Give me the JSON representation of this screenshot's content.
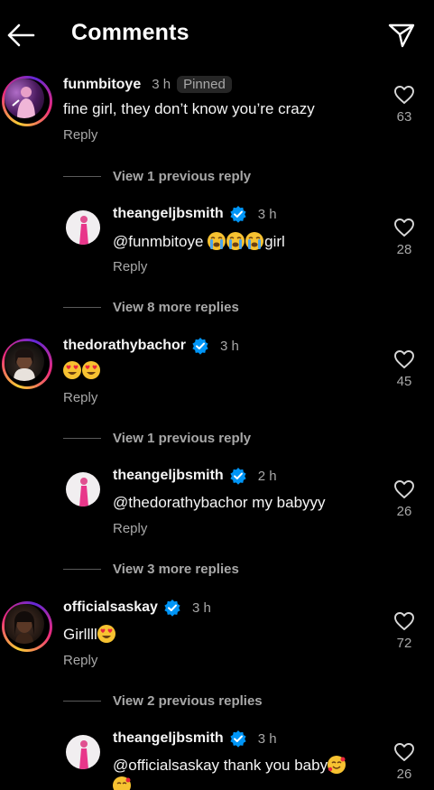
{
  "header": {
    "title": "Comments",
    "back_icon": "arrow-left-icon",
    "share_icon": "paper-plane-icon"
  },
  "colors": {
    "background": "#000000",
    "text": "#f5f5f5",
    "muted": "#a8a8a8",
    "verified": "#0095f6",
    "pinned_bg": "#262626"
  },
  "comments": [
    {
      "username": "funmbitoye",
      "time": "3 h",
      "pinned_label": "Pinned",
      "text": "fine girl, they don’t know you’re crazy",
      "reply_label": "Reply",
      "likes": "63",
      "verified": false
    },
    {
      "username": "theangeljbsmith",
      "time": "3 h",
      "text_prefix": "@funmbitoye ",
      "emojis": [
        "crying-face",
        "crying-face",
        "crying-face"
      ],
      "text_suffix": "girl",
      "reply_label": "Reply",
      "likes": "28",
      "verified": true
    },
    {
      "username": "thedorathybachor",
      "time": "3 h",
      "emojis": [
        "heart-eyes",
        "heart-eyes"
      ],
      "reply_label": "Reply",
      "likes": "45",
      "verified": true
    },
    {
      "username": "theangeljbsmith",
      "time": "2 h",
      "text": "@thedorathybachor my babyyy",
      "reply_label": "Reply",
      "likes": "26",
      "verified": true
    },
    {
      "username": "officialsaskay",
      "time": "3 h",
      "text": "Girllll",
      "emojis": [
        "heart-eyes"
      ],
      "reply_label": "Reply",
      "likes": "72",
      "verified": true
    },
    {
      "username": "theangeljbsmith",
      "time": "3 h",
      "text": "@officialsaskay thank you baby",
      "emojis": [
        "smiling-face-with-hearts",
        "smiling-face-with-hearts"
      ],
      "likes": "26",
      "verified": true
    }
  ],
  "view_links": [
    "View 1 previous reply",
    "View 8 more replies",
    "View 1 previous reply",
    "View 3 more replies",
    "View 2 previous replies"
  ]
}
